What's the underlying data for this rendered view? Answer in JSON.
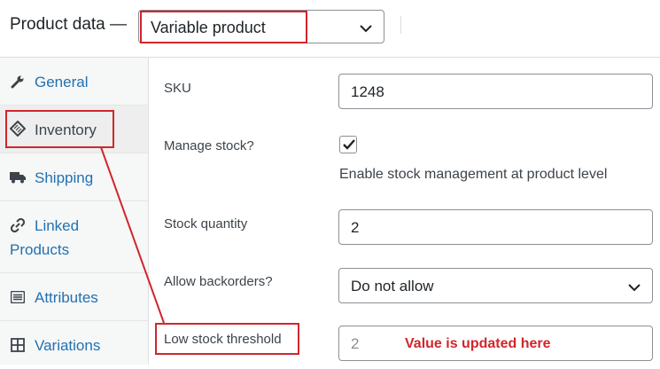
{
  "header": {
    "title": "Product data —",
    "product_type": "Variable product"
  },
  "tabs": [
    {
      "label": "General",
      "icon": "wrench-icon"
    },
    {
      "label": "Inventory",
      "icon": "tag-icon"
    },
    {
      "label": "Shipping",
      "icon": "truck-icon"
    },
    {
      "label_line1": "Linked",
      "label_line2": "Products",
      "icon": "link-icon"
    },
    {
      "label": "Attributes",
      "icon": "list-icon"
    },
    {
      "label": "Variations",
      "icon": "grid-icon"
    }
  ],
  "active_tab": "Inventory",
  "fields": {
    "sku": {
      "label": "SKU",
      "value": "1248"
    },
    "manage_stock": {
      "label": "Manage stock?",
      "checked": true,
      "description": "Enable stock management at product level"
    },
    "stock_quantity": {
      "label": "Stock quantity",
      "value": "2"
    },
    "backorders": {
      "label": "Allow backorders?",
      "value": "Do not allow"
    },
    "low_stock": {
      "label": "Low stock threshold",
      "value": "2"
    }
  },
  "annotation": {
    "note": "Value is updated here",
    "color": "#d0262c"
  },
  "colors": {
    "link": "#2271b1",
    "highlight": "#d0262c"
  }
}
